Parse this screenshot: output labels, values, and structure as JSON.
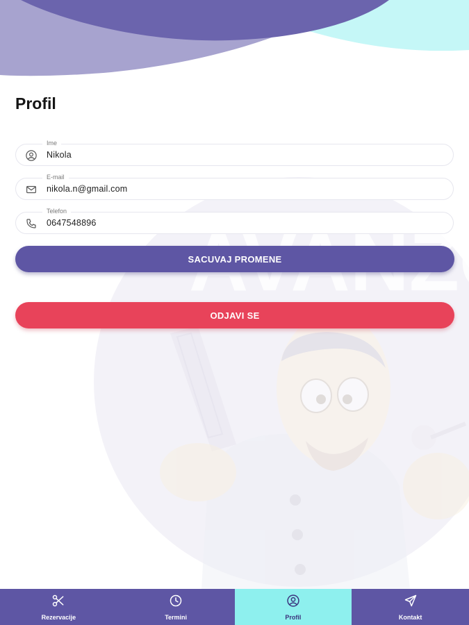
{
  "page": {
    "title": "Profil"
  },
  "form": {
    "name": {
      "label": "Ime",
      "value": "Nikola",
      "icon": "user-circle-icon"
    },
    "email": {
      "label": "E-mail",
      "value": "nikola.n@gmail.com",
      "icon": "mail-icon"
    },
    "phone": {
      "label": "Telefon",
      "value": "0647548896",
      "icon": "phone-icon"
    }
  },
  "buttons": {
    "save_label": "SACUVAJ PROMENE",
    "logout_label": "ODJAVI SE"
  },
  "background": {
    "watermark_text": "AVANZO"
  },
  "nav": {
    "items": [
      {
        "label": "Rezervacije",
        "icon": "scissors-icon",
        "active": false
      },
      {
        "label": "Termini",
        "icon": "clock-icon",
        "active": false
      },
      {
        "label": "Profil",
        "icon": "user-circle-icon",
        "active": true
      },
      {
        "label": "Kontakt",
        "icon": "send-icon",
        "active": false
      }
    ]
  },
  "colors": {
    "primary": "#5e56a4",
    "danger": "#e8435a",
    "accent": "#8ef0ee",
    "wave_light": "#a7a3cf"
  }
}
